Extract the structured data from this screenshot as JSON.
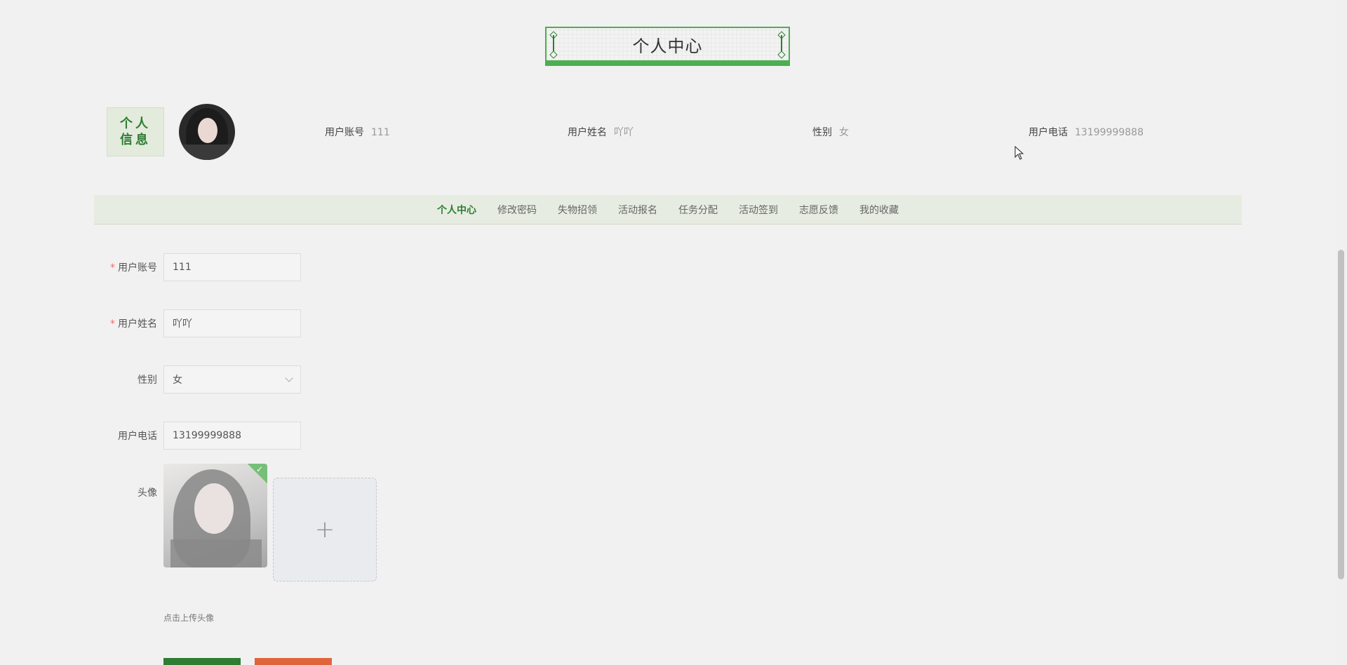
{
  "header": {
    "title": "个人中心"
  },
  "profile": {
    "tag_line1": "个人",
    "tag_line2": "信息",
    "fields": [
      {
        "label": "用户账号",
        "value": "111"
      },
      {
        "label": "用户姓名",
        "value": "吖吖"
      },
      {
        "label": "性别",
        "value": "女"
      },
      {
        "label": "用户电话",
        "value": "13199999888"
      }
    ]
  },
  "nav": {
    "items": [
      "个人中心",
      "修改密码",
      "失物招领",
      "活动报名",
      "任务分配",
      "活动签到",
      "志愿反馈",
      "我的收藏"
    ],
    "active_index": 0
  },
  "form": {
    "required_mark": "*",
    "account": {
      "label": "用户账号",
      "value": "111",
      "required": true
    },
    "name": {
      "label": "用户姓名",
      "value": "吖吖",
      "required": true
    },
    "gender": {
      "label": "性别",
      "value": "女"
    },
    "phone": {
      "label": "用户电话",
      "value": "13199999888"
    },
    "avatar": {
      "label": "头像",
      "upload_icon": "plus-icon",
      "tip": "点击上传头像"
    }
  },
  "colors": {
    "accent": "#2e7d32",
    "accent_light": "#4caf50",
    "nav_bg": "#e6ece1",
    "cancel": "#e0653a",
    "required": "#f56c6c"
  }
}
